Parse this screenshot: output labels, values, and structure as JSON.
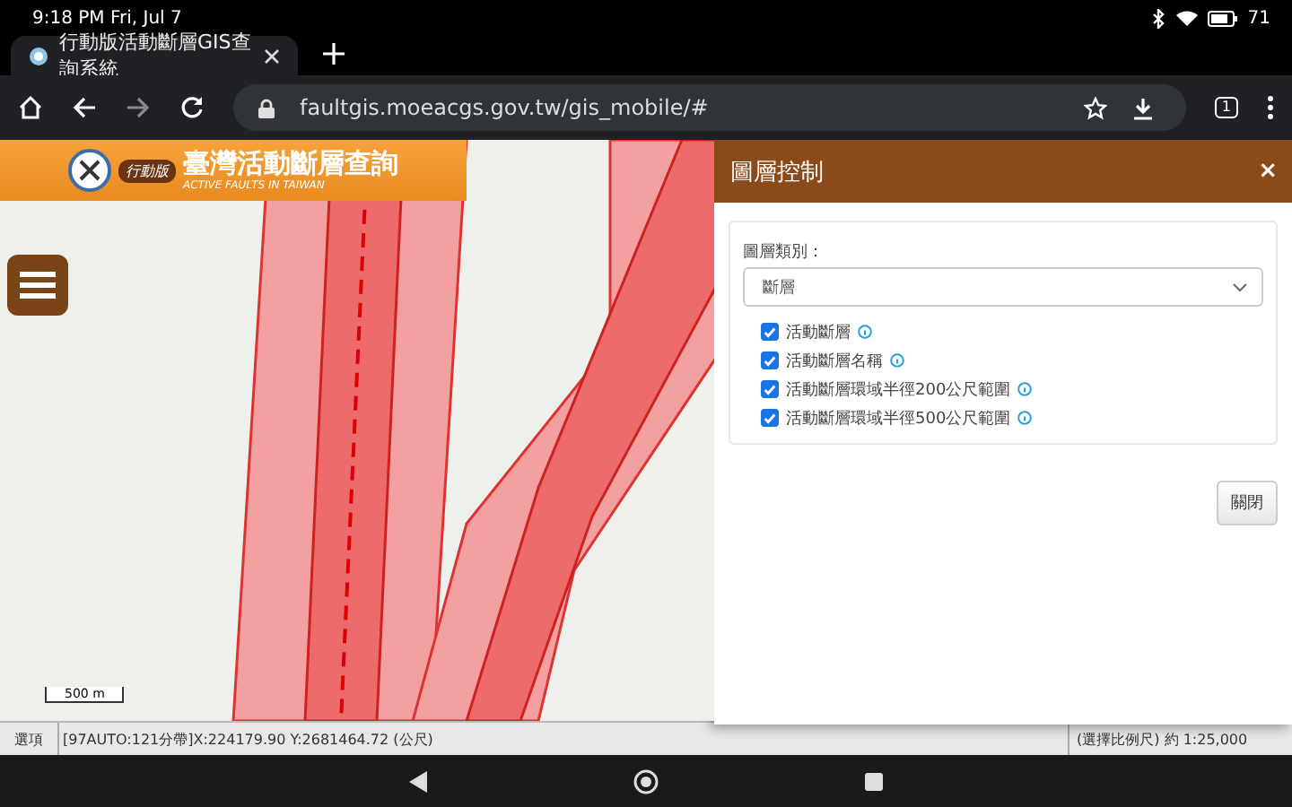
{
  "status_bar": {
    "time": "9:18 PM Fri, Jul 7",
    "battery": "71"
  },
  "browser": {
    "tab_title": "行動版活動斷層GIS查詢系統",
    "url": "faultgis.moeacgs.gov.tw/gis_mobile/#",
    "tab_count": "1"
  },
  "banner": {
    "badge": "行動版",
    "title": "臺灣活動斷層查詢",
    "subtitle": "ACTIVE FAULTS IN TAIWAN"
  },
  "map": {
    "scale": "500 m"
  },
  "panel": {
    "title": "圖層控制",
    "close": "×",
    "category_label": "圖層類別：",
    "category_value": "斷層",
    "layers": [
      {
        "label": "活動斷層",
        "checked": true
      },
      {
        "label": "活動斷層名稱",
        "checked": true
      },
      {
        "label": "活動斷層環域半徑200公尺範圍",
        "checked": true
      },
      {
        "label": "活動斷層環域半徑500公尺範圍",
        "checked": true
      }
    ],
    "close_button": "關閉"
  },
  "footer": {
    "options": "選項",
    "coords": "[97AUTO:121分帶]X:224179.90 Y:2681464.72 (公尺)",
    "scale": "(選擇比例尺) 約 1:25,000"
  }
}
